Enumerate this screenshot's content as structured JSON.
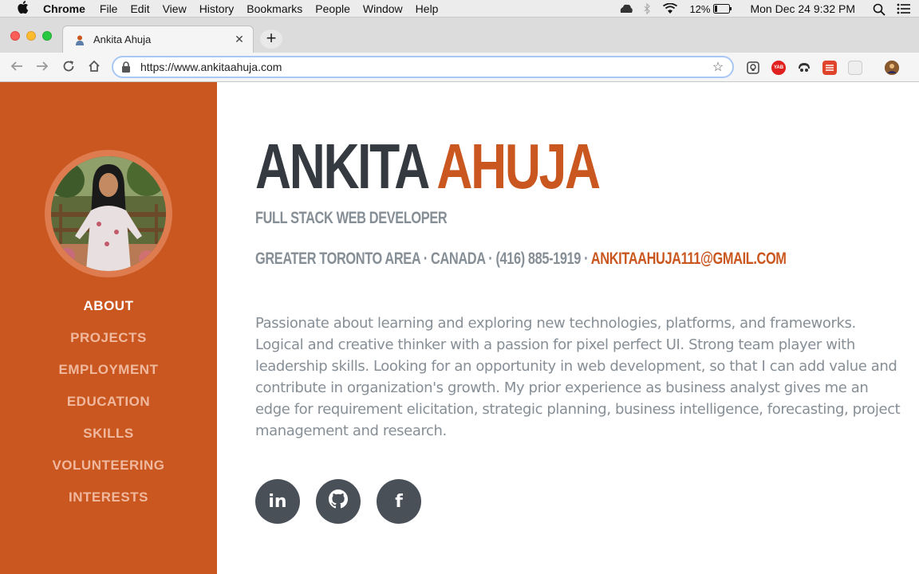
{
  "menubar": {
    "app_name": "Chrome",
    "items": [
      "File",
      "Edit",
      "View",
      "History",
      "Bookmarks",
      "People",
      "Window",
      "Help"
    ],
    "battery": "12%",
    "datetime": "Mon Dec 24  9:32 PM"
  },
  "browser": {
    "tab_title": "Ankita Ahuja",
    "url": "https://www.ankitaahuja.com"
  },
  "sidebar": {
    "nav": [
      "ABOUT",
      "PROJECTS",
      "EMPLOYMENT",
      "EDUCATION",
      "SKILLS",
      "VOLUNTEERING",
      "INTERESTS"
    ]
  },
  "about": {
    "first_name": "ANKITA",
    "last_name": "AHUJA",
    "subtitle": "FULL STACK WEB DEVELOPER",
    "contact_prefix": "GREATER TORONTO AREA · CANADA · (416) 885-1919 · ",
    "email": "ANKITAAHUJA111@GMAIL.COM",
    "bio": "Passionate about learning and exploring new technologies, platforms, and frameworks. Logical and creative thinker with a passion for pixel perfect UI. Strong team player with leadership skills. Looking for an opportunity in web development, so that I can add value and contribute in organization's growth. My prior experience as business analyst gives me an edge for requirement elicitation, strategic planning, business intelligence, forecasting, project management and research."
  },
  "social": {
    "linkedin_label": "in",
    "github_icon": "github-icon",
    "facebook_label": "f"
  },
  "colors": {
    "accent": "#c9571f",
    "dark": "#343a40",
    "muted": "#868e96"
  }
}
